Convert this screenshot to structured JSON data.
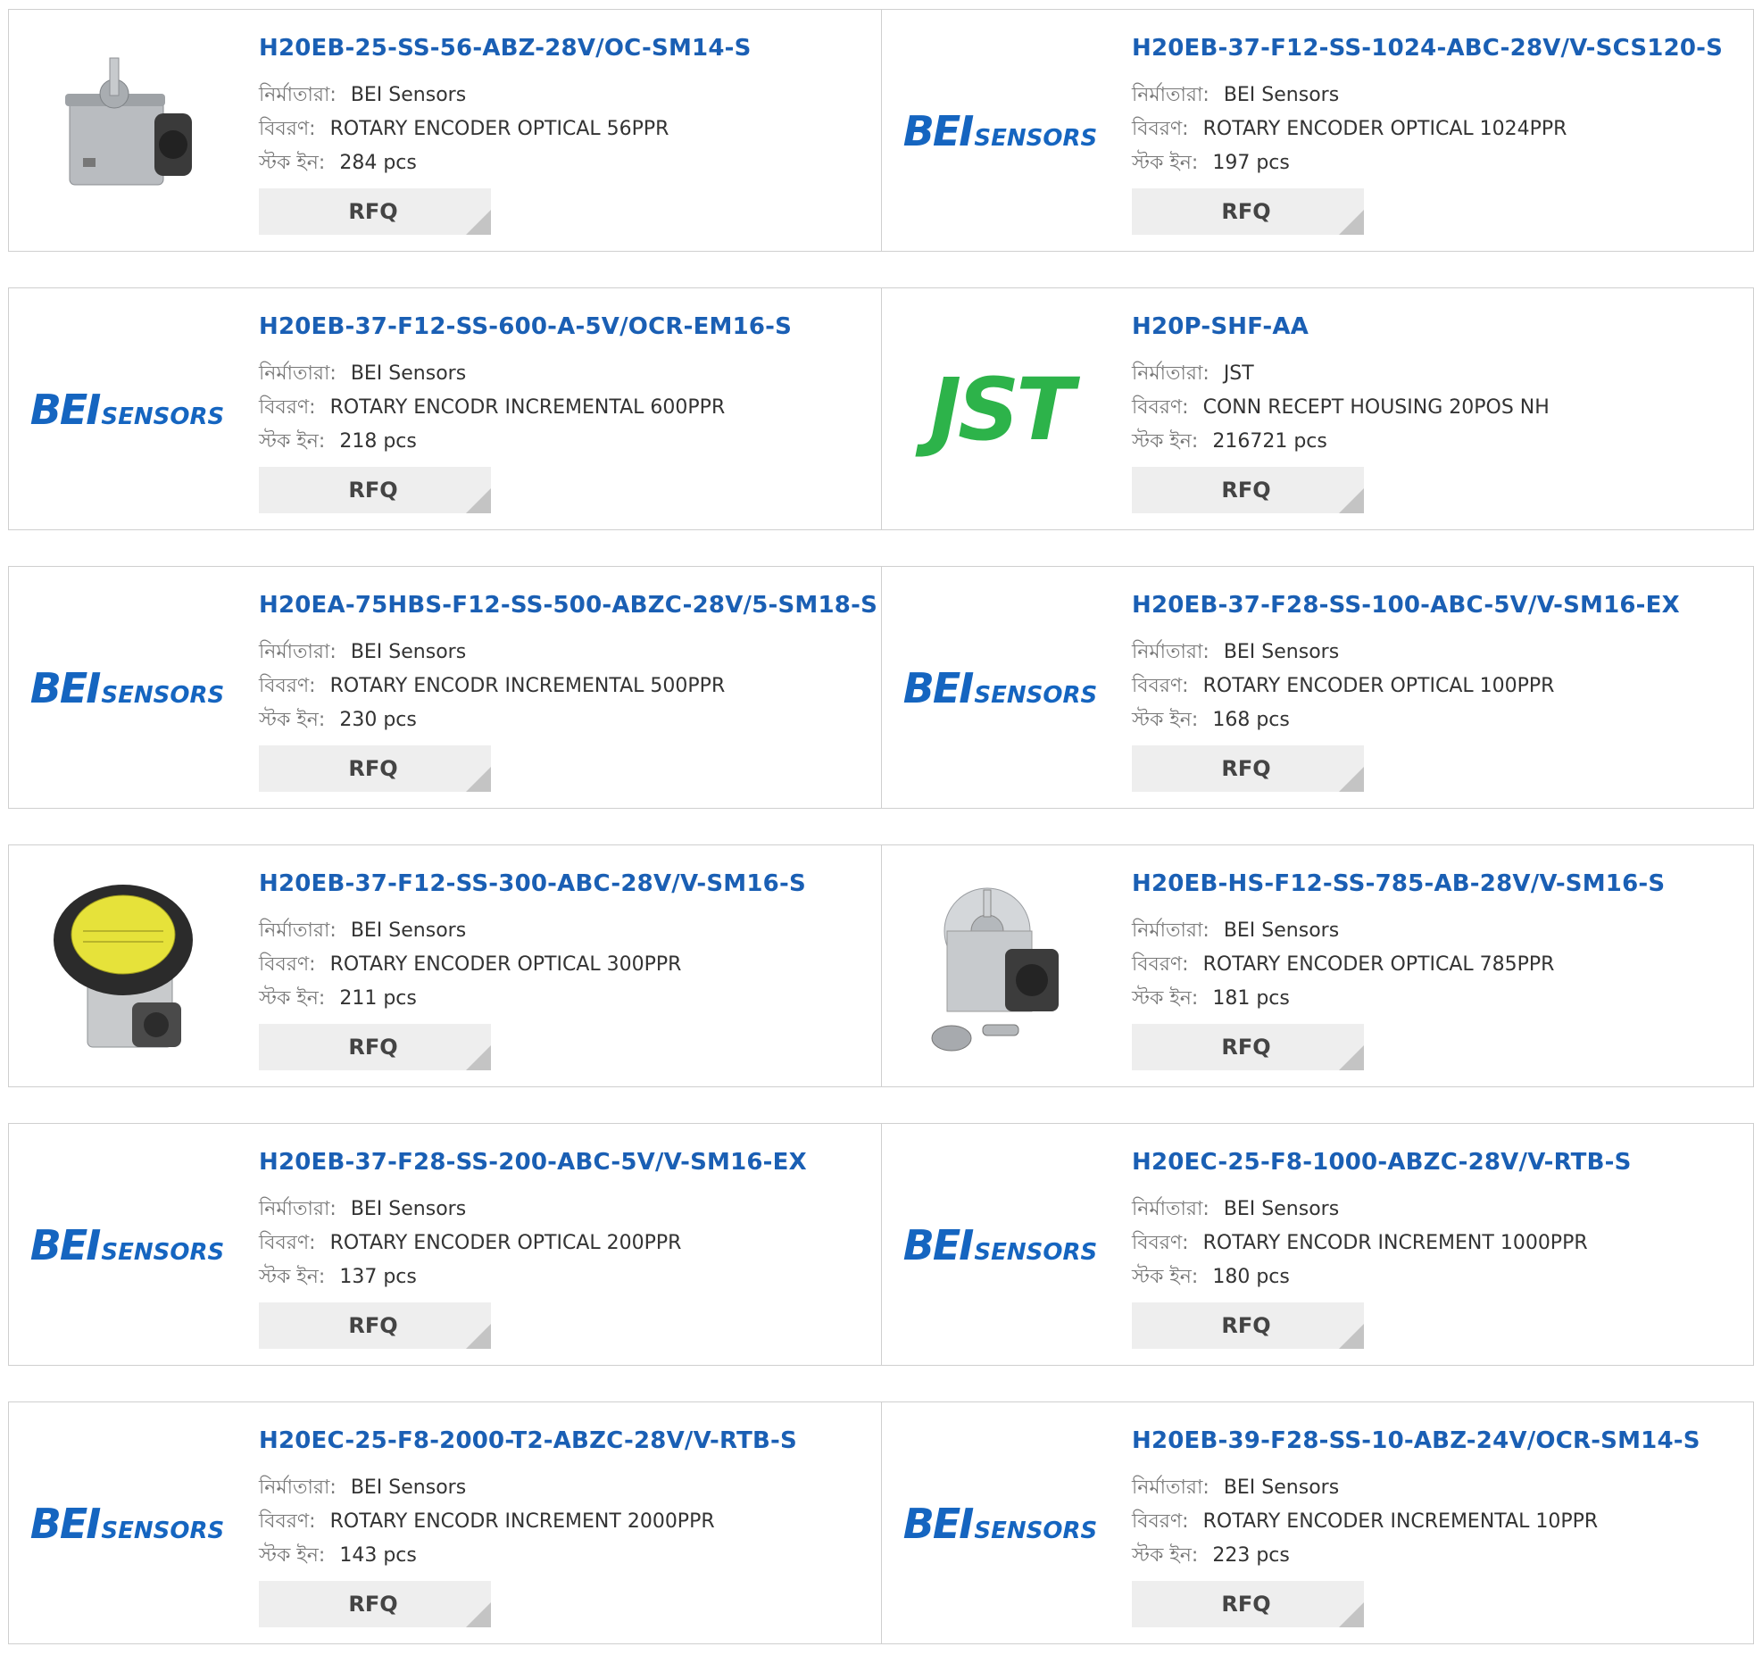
{
  "labels": {
    "manufacturer": "নির্মাতারা:",
    "description": "বিবরণ:",
    "stock": "স্টক ইন:",
    "rfq": "RFQ"
  },
  "logos": {
    "bei_main": "BEI",
    "bei_sub": "SENSORS",
    "jst": "JST"
  },
  "colors": {
    "title": "#1a5fb4",
    "bei_logo": "#1565c0",
    "jst_logo": "#2db34a",
    "rfq_bg": "#eeeeee"
  },
  "products": [
    {
      "part": "H20EB-25-SS-56-ABZ-28V/OC-SM14-S",
      "manufacturer": "BEI Sensors",
      "description": "ROTARY ENCODER OPTICAL 56PPR",
      "stock": "284 pcs",
      "image": "square-encoder-photo"
    },
    {
      "part": "H20EB-37-F12-SS-1024-ABC-28V/V-SCS120-S",
      "manufacturer": "BEI Sensors",
      "description": "ROTARY ENCODER OPTICAL 1024PPR",
      "stock": "197 pcs",
      "image": "bei-logo"
    },
    {
      "part": "H20EB-37-F12-SS-600-A-5V/OCR-EM16-S",
      "manufacturer": "BEI Sensors",
      "description": "ROTARY ENCODR INCREMENTAL 600PPR",
      "stock": "218 pcs",
      "image": "bei-logo"
    },
    {
      "part": "H20P-SHF-AA",
      "manufacturer": "JST",
      "description": "CONN RECEPT HOUSING 20POS NH",
      "stock": "216721 pcs",
      "image": "jst-logo"
    },
    {
      "part": "H20EA-75HBS-F12-SS-500-ABZC-28V/5-SM18-S",
      "manufacturer": "BEI Sensors",
      "description": "ROTARY ENCODR INCREMENTAL 500PPR",
      "stock": "230 pcs",
      "image": "bei-logo"
    },
    {
      "part": "H20EB-37-F28-SS-100-ABC-5V/V-SM16-EX",
      "manufacturer": "BEI Sensors",
      "description": "ROTARY ENCODER OPTICAL 100PPR",
      "stock": "168 pcs",
      "image": "bei-logo"
    },
    {
      "part": "H20EB-37-F12-SS-300-ABC-28V/V-SM16-S",
      "manufacturer": "BEI Sensors",
      "description": "ROTARY ENCODER OPTICAL 300PPR",
      "stock": "211 pcs",
      "image": "round-encoder-photo"
    },
    {
      "part": "H20EB-HS-F12-SS-785-AB-28V/V-SM16-S",
      "manufacturer": "BEI Sensors",
      "description": "ROTARY ENCODER OPTICAL 785PPR",
      "stock": "181 pcs",
      "image": "silver-encoder-photo"
    },
    {
      "part": "H20EB-37-F28-SS-200-ABC-5V/V-SM16-EX",
      "manufacturer": "BEI Sensors",
      "description": "ROTARY ENCODER OPTICAL 200PPR",
      "stock": "137 pcs",
      "image": "bei-logo"
    },
    {
      "part": "H20EC-25-F8-1000-ABZC-28V/V-RTB-S",
      "manufacturer": "BEI Sensors",
      "description": "ROTARY ENCODR INCREMENT 1000PPR",
      "stock": "180 pcs",
      "image": "bei-logo"
    },
    {
      "part": "H20EC-25-F8-2000-T2-ABZC-28V/V-RTB-S",
      "manufacturer": "BEI Sensors",
      "description": "ROTARY ENCODR INCREMENT 2000PPR",
      "stock": "143 pcs",
      "image": "bei-logo"
    },
    {
      "part": "H20EB-39-F28-SS-10-ABZ-24V/OCR-SM14-S",
      "manufacturer": "BEI Sensors",
      "description": "ROTARY ENCODER INCREMENTAL 10PPR",
      "stock": "223 pcs",
      "image": "bei-logo"
    }
  ]
}
